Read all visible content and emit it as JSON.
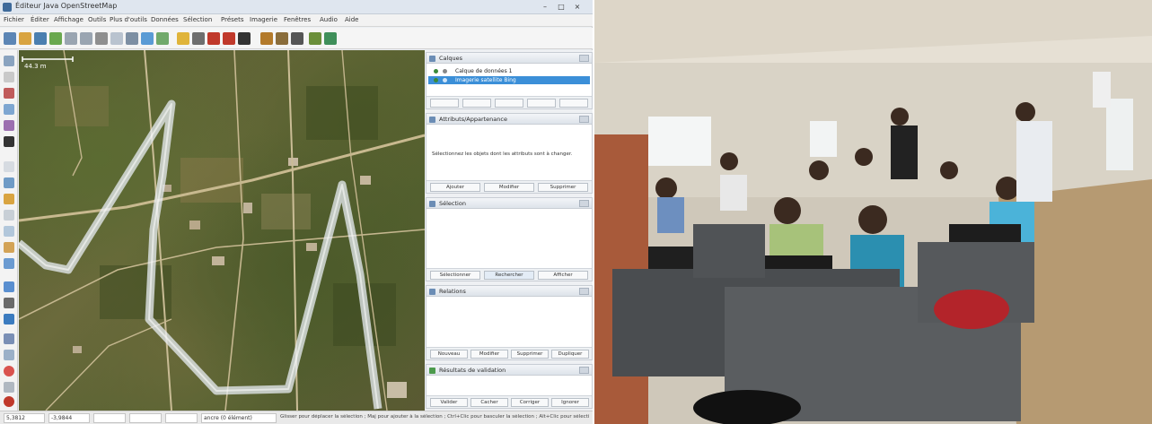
{
  "app": {
    "title": "Éditeur Java OpenStreetMap",
    "menu": [
      "Fichier",
      "Éditer",
      "Affichage",
      "Outils",
      "Plus d'outils",
      "Données",
      "Sélection",
      "Présets",
      "Imagerie",
      "Fenêtres",
      "Audio",
      "Aide"
    ],
    "toolbar_icons": [
      "new-file-icon",
      "open-file-icon",
      "save-icon",
      "upload-icon",
      "undo-icon",
      "redo-icon",
      "preferences-icon",
      "select-icon",
      "zoom-icon",
      "draw-icon",
      "relation-icon",
      "pin-icon",
      "marker-icon",
      "bus-icon",
      "car-icon",
      "tree-icon",
      "water-icon",
      "road-icon",
      "map-icon"
    ],
    "left_tools": [
      "select-tool-icon",
      "move-tool-icon",
      "zoom-tool-icon",
      "delete-tool-icon",
      "draw-tool-icon",
      "arrow-tool-icon",
      "node-tool-icon",
      "layer-tool-icon",
      "filter-tool-icon",
      "history-tool-icon",
      "validate-tool-icon",
      "favourite-tool-icon",
      "search-tool-icon",
      "location-tool-icon",
      "close-tool-icon"
    ],
    "map": {
      "scale_label": "44.3 m"
    },
    "layers_panel": {
      "title": "Calques",
      "rows": [
        {
          "label": "Calque de données 1",
          "selected": false
        },
        {
          "label": "Imagerie satellite Bing",
          "selected": true
        }
      ]
    },
    "tags_panel": {
      "title": "Attributs/Appartenance",
      "message": "Sélectionnez les objets dont les attributs sont à changer.",
      "buttons": [
        "Ajouter",
        "Modifier",
        "Supprimer"
      ]
    },
    "filter_panel": {
      "title": "Sélection",
      "buttons": [
        "Sélectionner",
        "Rechercher",
        "Afficher"
      ]
    },
    "relations_panel": {
      "title": "Relations",
      "buttons": [
        "Nouveau",
        "Modifier",
        "Supprimer",
        "Dupliquer"
      ]
    },
    "validation_panel": {
      "title": "Résultats de validation",
      "buttons": [
        "Valider",
        "Cacher",
        "Corriger",
        "Ignorer"
      ]
    },
    "status": {
      "lat": "5,3812",
      "lon": "-3,9844",
      "angle": "",
      "length": "",
      "heading": "",
      "zoom": "ancre (0 élément)",
      "help": "Glisser pour déplacer la sélection ; Maj pour ajouter à la sélection ; Ctrl+Clic pour basculer la sélection ; Alt+Clic pour sélectionner la sélection"
    }
  },
  "photo": {
    "description_free": true
  }
}
